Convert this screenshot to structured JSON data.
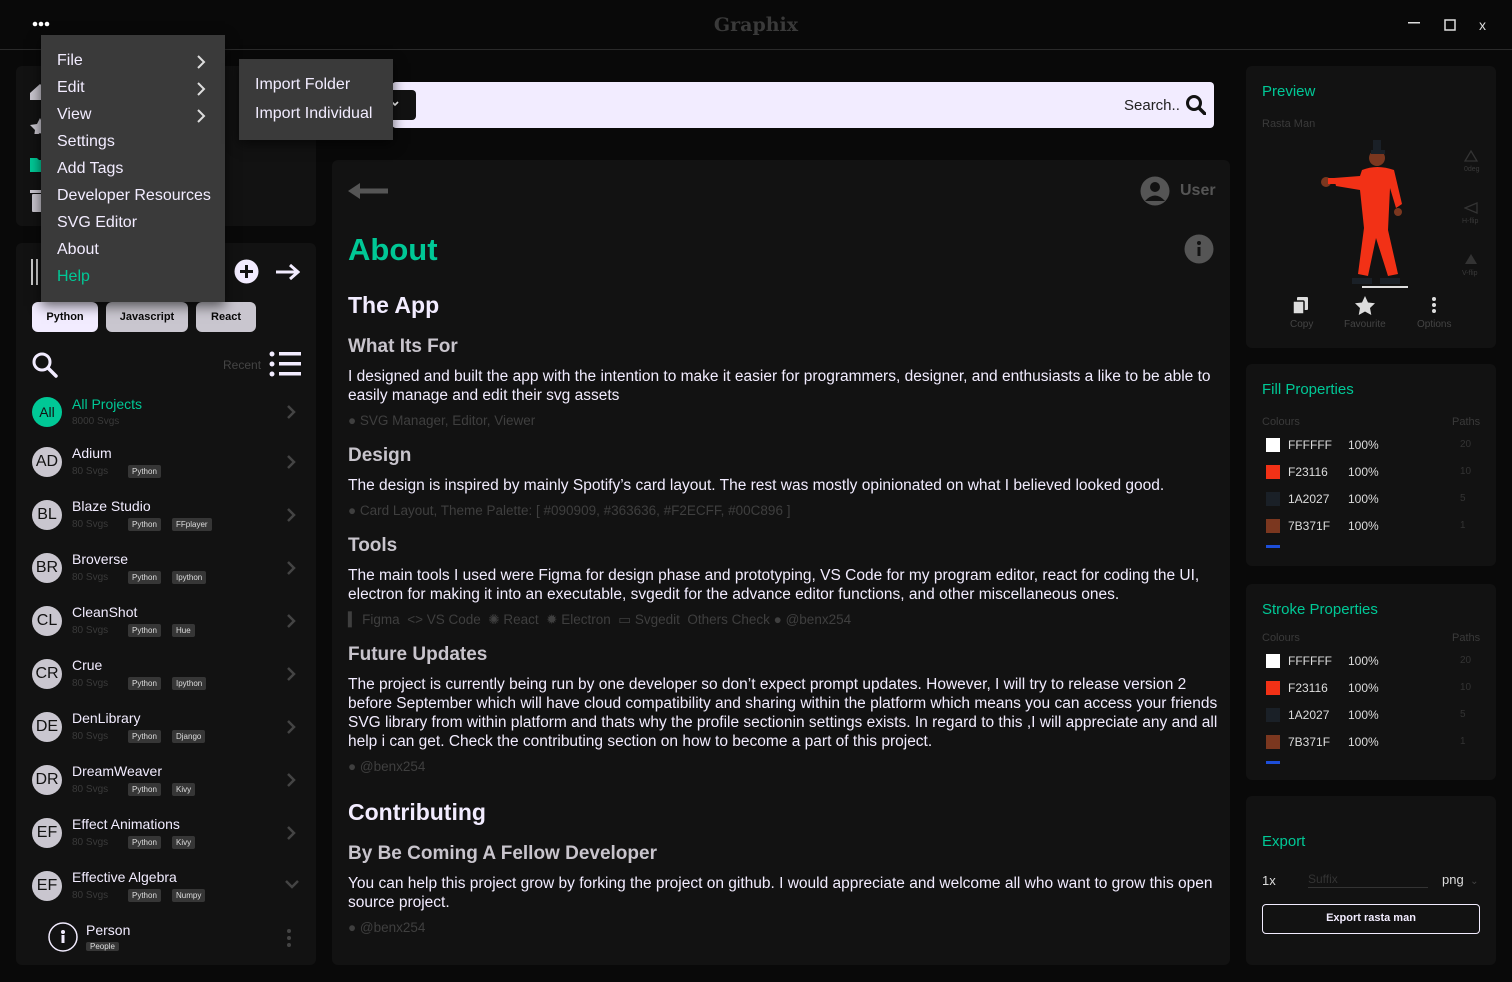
{
  "app": {
    "title": "Graphix"
  },
  "window": {
    "close": "x"
  },
  "menu": {
    "items": [
      {
        "label": "File",
        "submenu": true
      },
      {
        "label": "Edit",
        "submenu": true
      },
      {
        "label": "View",
        "submenu": true
      },
      {
        "label": "Settings"
      },
      {
        "label": "Add Tags"
      },
      {
        "label": "Developer Resources"
      },
      {
        "label": "SVG Editor"
      },
      {
        "label": "About"
      },
      {
        "label": "Help",
        "active": true
      }
    ],
    "file_submenu": [
      "Import Folder",
      "Import Individual"
    ]
  },
  "search": {
    "placeholder": "Search.."
  },
  "sidebar": {
    "tags": [
      "Python",
      "Javascript",
      "React"
    ],
    "recent_label": "Recent",
    "all_projects": {
      "avatar": "All",
      "name": "All Projects",
      "count": "8000 Svgs"
    },
    "projects": [
      {
        "avatar": "AD",
        "name": "Adium",
        "count": "80 Svgs",
        "tags": [
          "Python"
        ]
      },
      {
        "avatar": "BL",
        "name": "Blaze Studio",
        "count": "80 Svgs",
        "tags": [
          "Python",
          "FFplayer"
        ]
      },
      {
        "avatar": "BR",
        "name": "Broverse",
        "count": "80 Svgs",
        "tags": [
          "Python",
          "Ipython"
        ]
      },
      {
        "avatar": "CL",
        "name": "CleanShot",
        "count": "80 Svgs",
        "tags": [
          "Python",
          "Hue"
        ]
      },
      {
        "avatar": "CR",
        "name": "Crue",
        "count": "80 Svgs",
        "tags": [
          "Python",
          "Ipython"
        ]
      },
      {
        "avatar": "DE",
        "name": "DenLibrary",
        "count": "80 Svgs",
        "tags": [
          "Python",
          "Django"
        ]
      },
      {
        "avatar": "DR",
        "name": "DreamWeaver",
        "count": "80 Svgs",
        "tags": [
          "Python",
          "Kivy"
        ]
      },
      {
        "avatar": "EF",
        "name": "Effect Animations",
        "count": "80 Svgs",
        "tags": [
          "Python",
          "Kivy"
        ]
      },
      {
        "avatar": "EF",
        "name": "Effective Algebra",
        "count": "80 Svgs",
        "tags": [
          "Python",
          "Numpy"
        ]
      }
    ],
    "sub_item": {
      "name": "Person",
      "tag": "People"
    }
  },
  "main": {
    "user_label": "User",
    "title": "About",
    "app_heading": "The App",
    "what_heading": "What Its For",
    "what_text": "I designed and built the app with the intention to make it easier for programmers, designer, and enthusiasts a like to be able to easily manage and edit their svg assets",
    "what_meta": "SVG Manager, Editor, Viewer",
    "design_heading": "Design",
    "design_text": "The design is inspired by mainly Spotify’s card layout. The rest was mostly opinionated on what I believed looked good.",
    "design_meta": "Card Layout, Theme Palette: [ #090909, #363636, #F2ECFF, #00C896 ]",
    "tools_heading": "Tools",
    "tools_text": "The main tools I used were Figma for design phase and prototyping, VS Code for my program editor, react for coding the UI, electron for making it into an executable, svgedit for the advance editor functions, and other miscellaneous ones.",
    "tools_meta": [
      "Figma",
      "VS Code",
      "React",
      "Electron",
      "Svgedit",
      "Others Check",
      "@benx254"
    ],
    "future_heading": "Future Updates",
    "future_text": "The project is currently being run by one developer so don’t expect prompt updates. However,  I will try to release version 2 before September which will have cloud compatibility and sharing within the platform which means you can access your friends SVG library from within platform and thats why the profile sectionin settings exists. In regard to this ,I will appreciate any and all help i can get. Check the contributing section on how to become a part of this project.",
    "future_meta": "@benx254",
    "contrib_heading": "Contributing",
    "contrib_sub": "By Be Coming A Fellow Developer",
    "contrib_text": "You can help this project grow by forking the project on github. I would appreciate and welcome all who want to grow this open source project.",
    "contrib_meta": "@benx254"
  },
  "preview": {
    "title": "Preview",
    "name": "Rasta Man",
    "transforms": [
      "0deg",
      "H-flip",
      "V-flip"
    ],
    "actions": [
      "Copy",
      "Favourite",
      "Options"
    ]
  },
  "fill": {
    "title": "Fill Properties",
    "colours_label": "Colours",
    "paths_label": "Paths",
    "rows": [
      {
        "color": "#FFFFFF",
        "hex": "FFFFFF",
        "pct": "100%",
        "paths": "20"
      },
      {
        "color": "#F23116",
        "hex": "F23116",
        "pct": "100%",
        "paths": "10"
      },
      {
        "color": "#1A2027",
        "hex": "1A2027",
        "pct": "100%",
        "paths": "5"
      },
      {
        "color": "#7B371F",
        "hex": "7B371F",
        "pct": "100%",
        "paths": "1"
      }
    ]
  },
  "stroke": {
    "title": "Stroke Properties",
    "colours_label": "Colours",
    "paths_label": "Paths",
    "rows": [
      {
        "color": "#FFFFFF",
        "hex": "FFFFFF",
        "pct": "100%",
        "paths": "20"
      },
      {
        "color": "#F23116",
        "hex": "F23116",
        "pct": "100%",
        "paths": "10"
      },
      {
        "color": "#1A2027",
        "hex": "1A2027",
        "pct": "100%",
        "paths": "5"
      },
      {
        "color": "#7B371F",
        "hex": "7B371F",
        "pct": "100%",
        "paths": "1"
      }
    ]
  },
  "export": {
    "title": "Export",
    "scale": "1x",
    "suffix_placeholder": "Suffix",
    "format": "png",
    "button": "Export rasta man"
  },
  "colors": {
    "accent": "#00C896",
    "bg": "#090909",
    "panel": "#121212",
    "grey": "#363636",
    "text": "#F2ECFF"
  }
}
